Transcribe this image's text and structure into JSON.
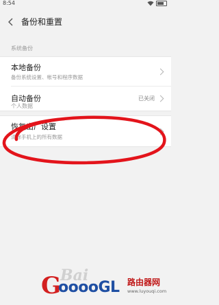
{
  "status_bar": {
    "time": "8:54"
  },
  "header": {
    "title": "备份和重置",
    "back_icon": "chevron-left-icon"
  },
  "sections": [
    {
      "label": "系统备份"
    },
    {
      "label": "个人数据"
    }
  ],
  "system_backup": {
    "local_backup": {
      "title": "本地备份",
      "subtitle": "备份系统设置、帐号和程序数据"
    },
    "auto_backup": {
      "title": "自动备份",
      "value": "已关闭"
    }
  },
  "personal_data": {
    "factory_reset": {
      "title": "恢复出厂设置",
      "subtitle": "清除手机上的所有数据"
    }
  },
  "annotation": {
    "color": "#e3141b"
  },
  "watermark": {
    "site_text": "Bai",
    "logo_g": "G",
    "logo_rest": "ooooGL",
    "logo_cn": "路由器网",
    "logo_url": "www.luyouqi.com"
  }
}
